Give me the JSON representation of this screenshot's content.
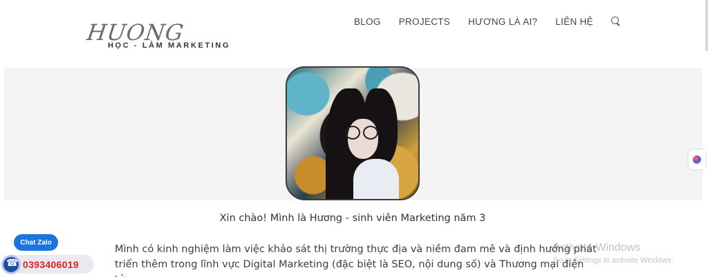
{
  "logo": {
    "script_text": "HUONG",
    "tagline": "HỌC - LÀM MARKETING"
  },
  "nav": {
    "items": [
      "BLOG",
      "PROJECTS",
      "HƯƠNG LÀ AI?",
      "LIÊN HỆ"
    ],
    "search_icon": "search-icon"
  },
  "intro": {
    "greeting": "Xin chào! Mình là Hương - sinh viên Marketing năm 3",
    "body": "Mình có kinh nghiệm làm việc khảo sát thị trường thực địa và niềm đam mê và định hướng phát triển thêm trong lĩnh vực Digital Marketing (đặc biệt là SEO, nội dung số) và Thương mại điện tử."
  },
  "watermark": {
    "title": "Activate Windows",
    "subtitle": "Go to Settings to activate Windows."
  },
  "contact": {
    "chat_label": "Chat Zalo",
    "phone": "0393406019"
  },
  "colors": {
    "zalo_blue": "#1b74e0",
    "phone_red": "#e02020",
    "hero_bg": "#f5f4f4"
  }
}
